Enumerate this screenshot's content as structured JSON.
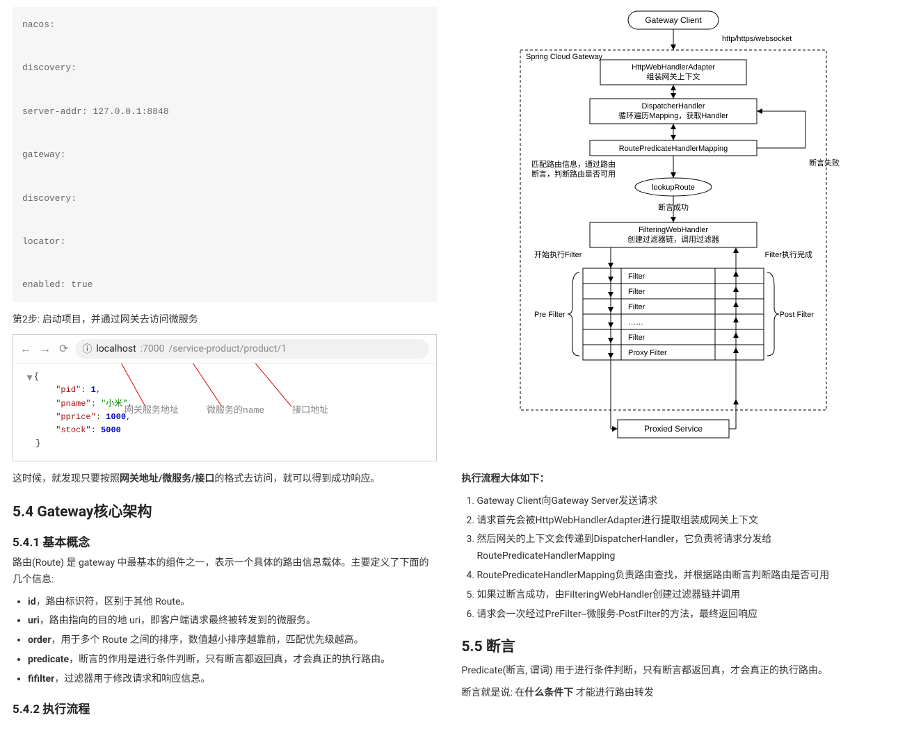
{
  "code_block": "nacos:\n\ndiscovery:\n\nserver-addr: 127.0.0.1:8848\n\ngateway:\n\ndiscovery:\n\nlocator:\n\nenabled: true",
  "step2": "第2步: 启动项目，并通过网关去访问微服务",
  "browser": {
    "info_icon": "ⓘ",
    "url_host": "localhost",
    "url_port": ":7000",
    "url_path": "/service-product/product/1"
  },
  "json_view": {
    "open": "{",
    "lines": [
      {
        "key": "\"pid\"",
        "sep": ": ",
        "val": "1",
        "valClass": "num",
        "trail": ","
      },
      {
        "key": "\"pname\"",
        "sep": ": ",
        "val": "\"小米\"",
        "valClass": "str",
        "trail": ","
      },
      {
        "key": "\"pprice\"",
        "sep": ": ",
        "val": "1000",
        "valClass": "num",
        "trail": ","
      },
      {
        "key": "\"stock\"",
        "sep": ": ",
        "val": "5000",
        "valClass": "num",
        "trail": ""
      }
    ],
    "close": "}"
  },
  "annotations": {
    "gateway_addr": "网关服务地址",
    "service_name": "微服务的name",
    "api_path": "接口地址"
  },
  "after_browser_p1_a": "这时候，就发现只要按照",
  "after_browser_p1_b": "网关地址/微服务/接口",
  "after_browser_p1_c": "的格式去访问，就可以得到成功响应。",
  "h2_54": "5.4 Gateway核心架构",
  "h3_541": "5.4.1 基本概念",
  "p_541": "路由(Route) 是 gateway 中最基本的组件之一，表示一个具体的路由信息载体。主要定义了下面的几个信息:",
  "basic_items": [
    {
      "b": "id",
      "rest": "，路由标识符，区别于其他 Route。"
    },
    {
      "b": "uri",
      "rest": "，路由指向的目的地 uri，即客户端请求最终被转发到的微服务。"
    },
    {
      "b": "order",
      "rest": "，用于多个 Route 之间的排序，数值越小排序越靠前，匹配优先级越高。"
    },
    {
      "b": "predicate",
      "rest": "，断言的作用是进行条件判断，只有断言都返回真，才会真正的执行路由。"
    },
    {
      "b": "fifilter",
      "rest": "，过滤器用于修改请求和响应信息。"
    }
  ],
  "h3_542": "5.4.2 执行流程",
  "diagram": {
    "gateway_client": "Gateway Client",
    "protocols": "http/https/websocket",
    "scg_label": "Spring Cloud Gateway",
    "adapter_t1": "HttpWebHandlerAdapter",
    "adapter_t2": "组装网关上下文",
    "dispatcher_t1": "DispatcherHandler",
    "dispatcher_t2": "循环遍历Mapping，获取Handler",
    "rphm": "RoutePredicateHandlerMapping",
    "match_t1": "匹配路由信息，通过路由",
    "match_t2": "断言，判断路由是否可用",
    "assert_fail": "断言失败",
    "lookup": "lookupRoute",
    "assert_ok": "断言成功",
    "fwh_t1": "FilteringWebHandler",
    "fwh_t2": "创建过滤器链，调用过滤器",
    "start_filter": "开始执行Filter",
    "filter_done": "Filter执行完成",
    "pre_filter": "Pre Filter",
    "post_filter": "Post Filter",
    "filters": [
      "Filter",
      "Filter",
      "Filter",
      "……",
      "Filter",
      "Proxy Filter"
    ],
    "proxied": "Proxied Service"
  },
  "exec_title": "执行流程大体如下：",
  "exec_steps": [
    "Gateway Client向Gateway Server发送请求",
    "请求首先会被HttpWebHandlerAdapter进行提取组装成网关上下文",
    "然后网关的上下文会传递到DispatcherHandler，它负责将请求分发给RoutePredicateHandlerMapping",
    "RoutePredicateHandlerMapping负责路由查找，并根据路由断言判断路由是否可用",
    "如果过断言成功，由FilteringWebHandler创建过滤器链并调用",
    "请求会一次经过PreFilter--微服务-PostFilter的方法，最终返回响应"
  ],
  "h2_55": "5.5 断言",
  "p_55_1": "Predicate(断言, 谓词) 用于进行条件判断，只有断言都返回真，才会真正的执行路由。",
  "p_55_2a": "断言就是说: 在",
  "p_55_2b": "什么条件下",
  "p_55_2c": " 才能进行路由转发"
}
